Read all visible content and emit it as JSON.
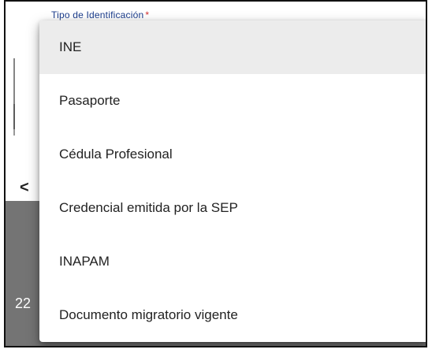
{
  "field": {
    "label": "Tipo de Identificación",
    "required_mark": "*"
  },
  "background": {
    "side_number": "22",
    "prev_arrow": "<"
  },
  "dropdown": {
    "options": [
      "INE",
      "Pasaporte",
      "Cédula Profesional",
      "Credencial emitida por la SEP",
      "INAPAM",
      "Documento migratorio vigente"
    ],
    "selected_index": 0
  }
}
